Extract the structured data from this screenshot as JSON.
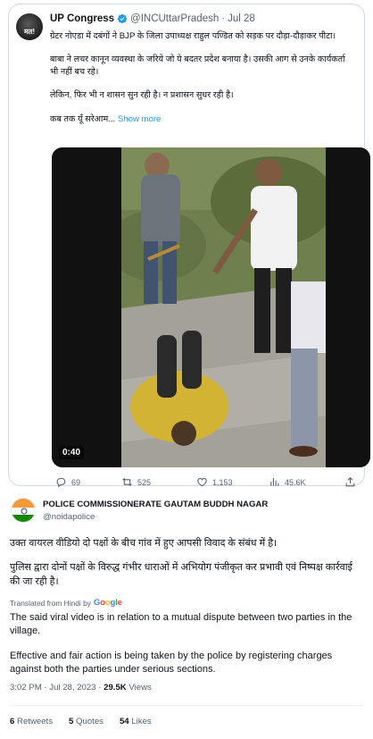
{
  "quoted_tweet": {
    "avatar_text": "मत!",
    "name": "UP Congress",
    "handle": "@INCUttarPradesh",
    "separator": "·",
    "date": "Jul 28",
    "paragraph1": "ग्रेटर नोएडा में दबंगों ने BJP के जिला उपाध्यक्ष राहुल पण्डित को सड़क पर दौड़ा-दौड़ाकर पीटा।",
    "paragraph2": "बाबा ने लचर कानून व्यवस्था के जरिये जो ये बदतर प्रदेश बनाया है। उसकी आग से उनके कार्यकर्ता भी नहीं बच रहे।",
    "paragraph3": "लेकिन, फिर भी न शासन सुन रही है। न प्रशासन सुधर रही है।",
    "paragraph4": "कब तक यूँ सरेआम...",
    "show_more": "Show more",
    "video_duration": "0:40",
    "actions": {
      "replies": "69",
      "retweets": "525",
      "likes": "1,153",
      "views": "45.6K"
    }
  },
  "tweet": {
    "name": "POLICE COMMISSIONERATE GAUTAM BUDDH NAGAR",
    "handle": "@noidapolice",
    "paragraph1": "उक्त वायरल वीडियो दो पक्षों के बीच गांव में हुए आपसी विवाद के संबंध में है।",
    "paragraph2": "पुलिस द्वारा दोनों पक्षों के विरुद्ध गंभीर धाराओं में अभियोग पंजीकृत कर प्रभावी एवं निष्पक्ष कार्रवाई की जा रही है।",
    "translated_label": "Translated from Hindi by",
    "translation_p1": "The said viral video is in relation to a mutual dispute between two parties in the village.",
    "translation_p2": "Effective and fair action is being taken by the police by registering charges against both the parties under serious sections.",
    "time": "3:02 PM",
    "separator": "·",
    "date": "Jul 28, 2023",
    "views_count": "29.5K",
    "views_label": "Views",
    "retweets_count": "6",
    "retweets_label": "Retweets",
    "quotes_count": "5",
    "quotes_label": "Quotes",
    "likes_count": "54",
    "likes_label": "Likes"
  },
  "colors": {
    "accent": "#1d9bf0",
    "secondary_text": "#536471",
    "border": "#cfd9de"
  }
}
